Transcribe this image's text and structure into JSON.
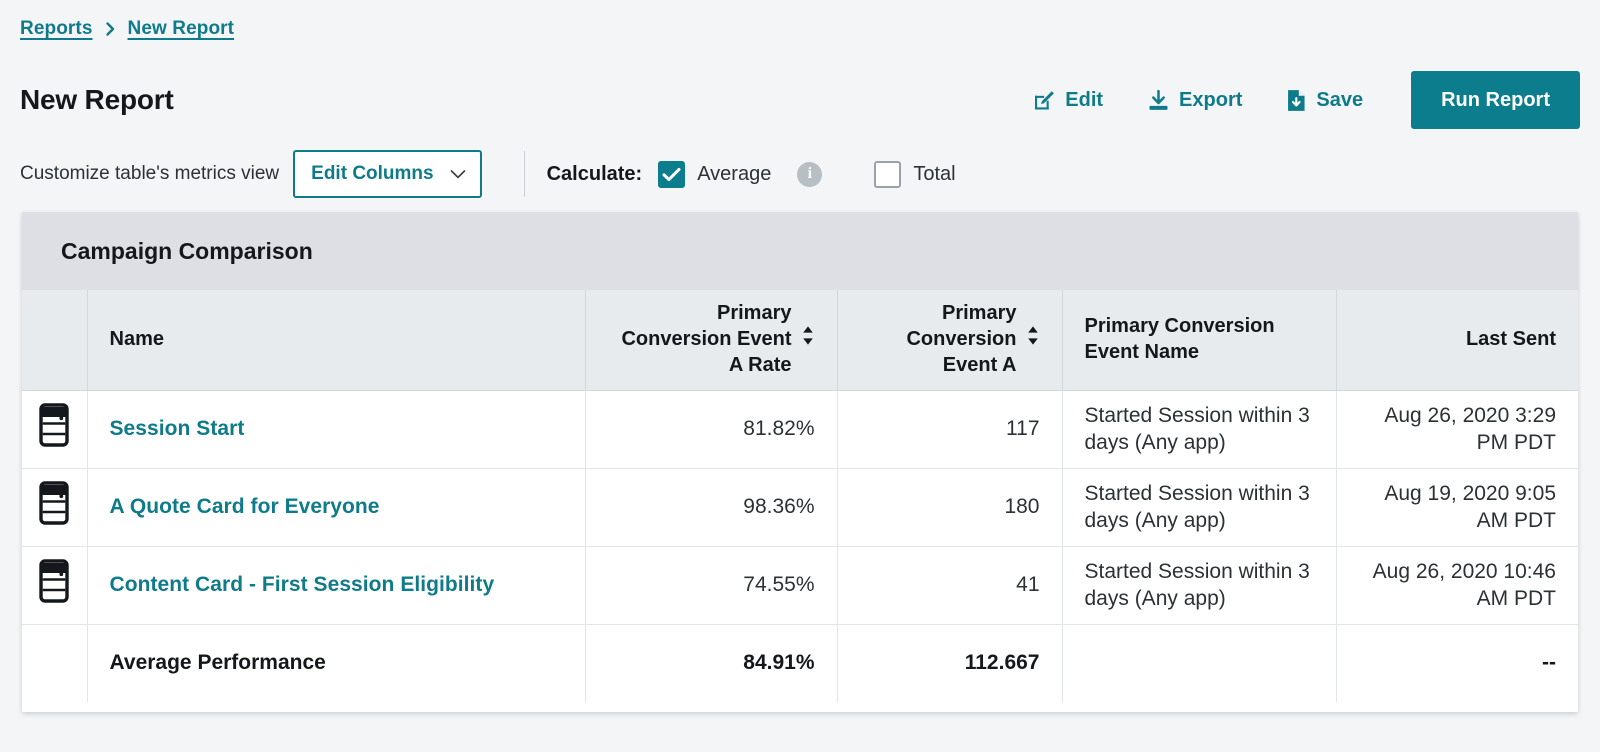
{
  "breadcrumb": {
    "items": [
      {
        "label": "Reports"
      },
      {
        "label": "New Report"
      }
    ],
    "separator_icon": "chevron-right-icon"
  },
  "header": {
    "title": "New Report",
    "actions": [
      {
        "label": "Edit",
        "icon": "pencil-square-icon"
      },
      {
        "label": "Export",
        "icon": "download-icon"
      },
      {
        "label": "Save",
        "icon": "save-document-icon"
      }
    ],
    "primary_button": {
      "label": "Run Report"
    }
  },
  "controls": {
    "customize_label": "Customize table's metrics view",
    "edit_columns": {
      "value": "Edit Columns",
      "icon": "chevron-down-icon"
    },
    "calculate_label": "Calculate:",
    "options": [
      {
        "label": "Average",
        "checked": true,
        "info_icon": "info-icon"
      },
      {
        "label": "Total",
        "checked": false
      }
    ]
  },
  "card": {
    "title": "Campaign Comparison",
    "columns": [
      {
        "key": "icon",
        "label": "",
        "sortable": false
      },
      {
        "key": "name",
        "label": "Name",
        "sortable": false
      },
      {
        "key": "rate",
        "label": "Primary Conversion Event A Rate",
        "sortable": true
      },
      {
        "key": "count",
        "label": "Primary Conversion Event A",
        "sortable": true
      },
      {
        "key": "event",
        "label": "Primary Conversion Event Name",
        "sortable": false
      },
      {
        "key": "last_sent",
        "label": "Last Sent",
        "sortable": false
      }
    ],
    "column_labels": {
      "name": "Name",
      "rate_line1": "Primary",
      "rate_line2": "Conversion Event",
      "rate_line3": "A Rate",
      "count_line1": "Primary",
      "count_line2": "Conversion",
      "count_line3": "Event A",
      "event_line1": "Primary Conversion",
      "event_line2": "Event Name",
      "last_sent": "Last Sent"
    },
    "rows": [
      {
        "icon": "content-card-icon",
        "name": "Session Start",
        "rate": "81.82%",
        "count": "117",
        "event": "Started Session within 3 days (Any app)",
        "last_sent": "Aug 26, 2020 3:29 PM PDT"
      },
      {
        "icon": "content-card-icon",
        "name": "A Quote Card for Everyone",
        "rate": "98.36%",
        "count": "180",
        "event": "Started Session within 3 days (Any app)",
        "last_sent": "Aug 19, 2020 9:05 AM PDT"
      },
      {
        "icon": "content-card-icon",
        "name": "Content Card - First Session Eligibility",
        "rate": "74.55%",
        "count": "41",
        "event": "Started Session within 3 days (Any app)",
        "last_sent": "Aug 26, 2020 10:46 AM PDT"
      }
    ],
    "footer": {
      "label": "Average Performance",
      "rate": "84.91%",
      "count": "112.667",
      "event": "",
      "last_sent": "--"
    }
  },
  "colors": {
    "accent": "#0f7b8a",
    "primary_button": "#0b7d8c",
    "page_background": "#f4f5f7",
    "card_header": "#dedfe4",
    "table_header": "#e8ebed",
    "text": "#14181c"
  }
}
